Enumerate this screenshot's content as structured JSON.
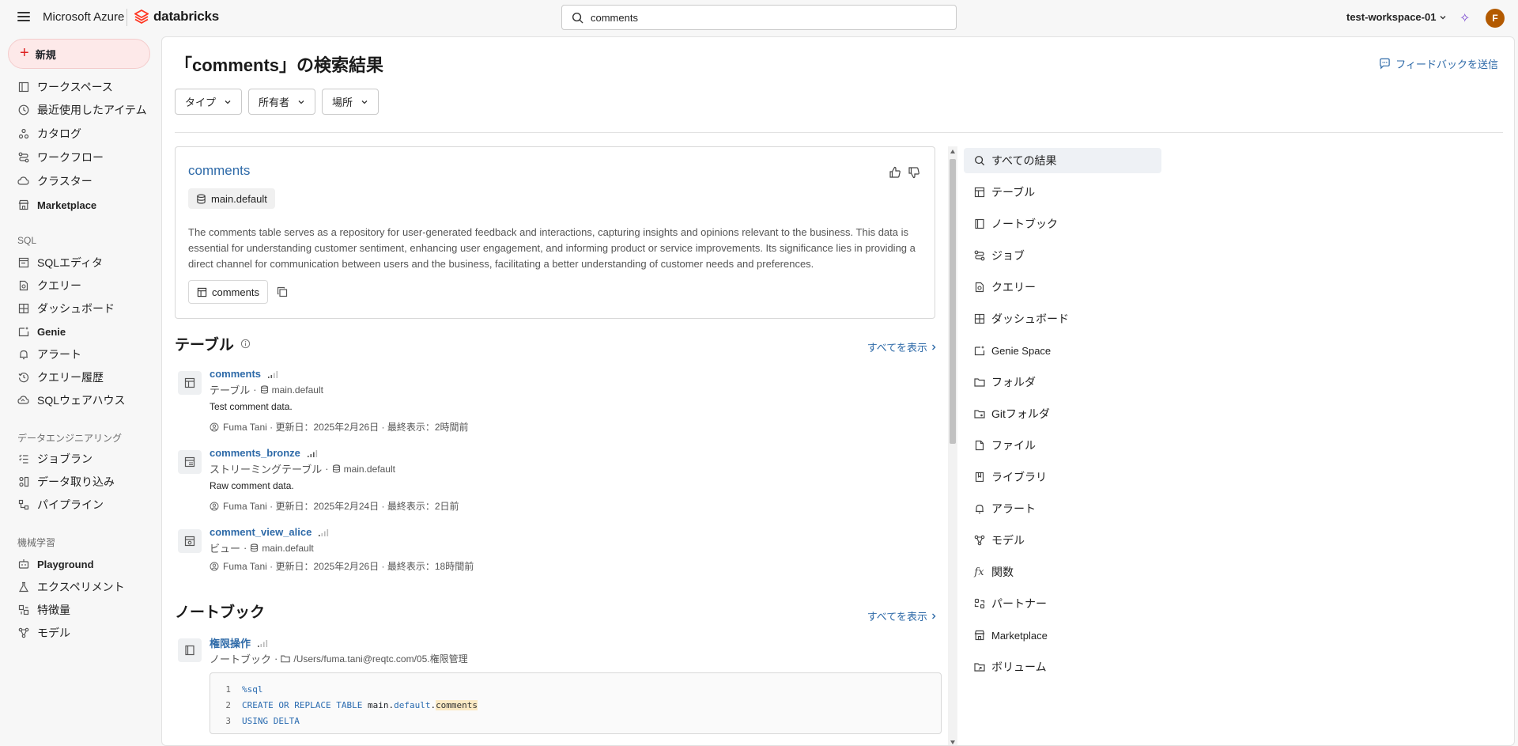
{
  "topbar": {
    "brand_ms": "Microsoft Azure",
    "brand_db": "databricks",
    "search_value": "comments",
    "workspace": "test-workspace-01",
    "avatar_letter": "F"
  },
  "sidebar": {
    "new_label": "新規",
    "items_top": [
      {
        "label": "ワークスペース",
        "icon": "workspace-icon"
      },
      {
        "label": "最近使用したアイテム",
        "icon": "clock-icon"
      },
      {
        "label": "カタログ",
        "icon": "catalog-icon"
      },
      {
        "label": "ワークフロー",
        "icon": "workflow-icon"
      },
      {
        "label": "クラスター",
        "icon": "cloud-icon"
      },
      {
        "label": "Marketplace",
        "icon": "store-icon"
      }
    ],
    "sql_section": "SQL",
    "items_sql": [
      {
        "label": "SQLエディタ",
        "icon": "sql-editor-icon"
      },
      {
        "label": "クエリー",
        "icon": "query-icon"
      },
      {
        "label": "ダッシュボード",
        "icon": "dashboard-icon"
      },
      {
        "label": "Genie",
        "icon": "genie-icon"
      },
      {
        "label": "アラート",
        "icon": "bell-icon"
      },
      {
        "label": "クエリー履歴",
        "icon": "history-icon"
      },
      {
        "label": "SQLウェアハウス",
        "icon": "warehouse-icon"
      }
    ],
    "de_section": "データエンジニアリング",
    "items_de": [
      {
        "label": "ジョブラン",
        "icon": "job-runs-icon"
      },
      {
        "label": "データ取り込み",
        "icon": "ingest-icon"
      },
      {
        "label": "パイプライン",
        "icon": "pipeline-icon"
      }
    ],
    "ml_section": "機械学習",
    "items_ml": [
      {
        "label": "Playground",
        "icon": "playground-icon"
      },
      {
        "label": "エクスペリメント",
        "icon": "experiment-icon"
      },
      {
        "label": "特徴量",
        "icon": "feature-icon"
      },
      {
        "label": "モデル",
        "icon": "model-icon"
      }
    ]
  },
  "main": {
    "title": "「comments」の検索結果",
    "feedback": "フィードバックを送信",
    "filters": [
      "タイプ",
      "所有者",
      "場所"
    ],
    "top_card": {
      "title": "comments",
      "schema": "main.default",
      "description": "The comments table serves as a repository for user-generated feedback and interactions, capturing insights and opinions relevant to the business. This data is essential for understanding customer sentiment, enhancing user engagement, and informing product or service improvements. Its significance lies in providing a direct channel for communication between users and the business, facilitating a better understanding of customer needs and preferences.",
      "table_chip": "comments"
    },
    "tables_section": {
      "title": "テーブル",
      "view_all": "すべてを表示",
      "results": [
        {
          "name": "comments",
          "type": "テーブル",
          "schema": "main.default",
          "desc": "Test comment data.",
          "owner": "Fuma Tani · 更新日：2025年2月26日 · 最終表示：2時間前"
        },
        {
          "name": "comments_bronze",
          "type": "ストリーミングテーブル",
          "schema": "main.default",
          "desc": "Raw comment data.",
          "owner": "Fuma Tani · 更新日：2025年2月24日 · 最終表示：2日前"
        },
        {
          "name": "comment_view_alice",
          "type": "ビュー",
          "schema": "main.default",
          "desc": "",
          "owner": "Fuma Tani · 更新日：2025年2月26日 · 最終表示：18時間前"
        }
      ]
    },
    "notebooks_section": {
      "title": "ノートブック",
      "view_all": "すべてを表示",
      "result": {
        "name": "権限操作",
        "type": "ノートブック",
        "path": "/Users/fuma.tani@reqtc.com/05.権限管理"
      },
      "code": {
        "line1_num": "1",
        "line1": "%sql",
        "line2_num": "2",
        "line2_kw": "CREATE OR REPLACE TABLE",
        "line2_a": "main.",
        "line2_b": "default",
        "line2_c": ".",
        "line2_hl": "comments",
        "line3_num": "3",
        "line3": "USING DELTA"
      }
    },
    "type_filters": [
      {
        "label": "すべての結果",
        "icon": "search-icon",
        "active": true
      },
      {
        "label": "テーブル",
        "icon": "table-icon"
      },
      {
        "label": "ノートブック",
        "icon": "notebook-icon"
      },
      {
        "label": "ジョブ",
        "icon": "job-icon"
      },
      {
        "label": "クエリー",
        "icon": "query-icon"
      },
      {
        "label": "ダッシュボード",
        "icon": "dashboard-icon"
      },
      {
        "label": "Genie Space",
        "icon": "genie-icon"
      },
      {
        "label": "フォルダ",
        "icon": "folder-icon"
      },
      {
        "label": "Gitフォルダ",
        "icon": "git-folder-icon"
      },
      {
        "label": "ファイル",
        "icon": "file-icon"
      },
      {
        "label": "ライブラリ",
        "icon": "library-icon"
      },
      {
        "label": "アラート",
        "icon": "bell-icon"
      },
      {
        "label": "モデル",
        "icon": "model-icon"
      },
      {
        "label": "関数",
        "icon": "function-icon"
      },
      {
        "label": "パートナー",
        "icon": "partner-icon"
      },
      {
        "label": "Marketplace",
        "icon": "store-icon"
      },
      {
        "label": "ボリューム",
        "icon": "volume-icon"
      }
    ]
  },
  "colors": {
    "accent": "#2e6aa8",
    "brand": "#ff3621",
    "new_bg": "#fde9e9"
  }
}
